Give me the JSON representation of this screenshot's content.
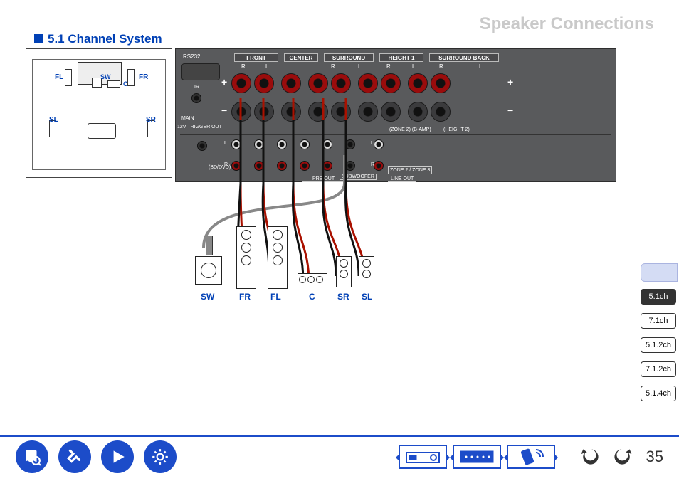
{
  "header": {
    "title": "Speaker Connections"
  },
  "section": {
    "title": "5.1 Channel System"
  },
  "room": {
    "labels": {
      "FL": "FL",
      "FR": "FR",
      "SW": "SW",
      "C": "C",
      "SL": "SL",
      "SR": "SR"
    }
  },
  "panel": {
    "port_labels": {
      "rs232": "RS232",
      "ir": "IR",
      "main": "MAIN",
      "trigger": "12V TRIGGER OUT",
      "subwoofer": "SUBWOOFER",
      "preout": "PRE OUT",
      "zone2_zone3": "ZONE 2 / ZONE 3",
      "lineout": "LINE OUT",
      "zone2_preamp": "(ZONE 2) (B-AMP)",
      "height2": "(HEIGHT 2)",
      "bd_dvd": "(BD/DVD)",
      "L": "L",
      "R": "R"
    },
    "groups": {
      "front": "FRONT",
      "center": "CENTER",
      "surround": "SURROUND",
      "height1": "HEIGHT 1",
      "surround_back": "SURROUND BACK"
    },
    "channel_letters": {
      "R": "R",
      "L": "L"
    },
    "polarity": {
      "plus": "+",
      "minus": "−"
    }
  },
  "speaker_labels": {
    "SW": "SW",
    "FR": "FR",
    "FL": "FL",
    "C": "C",
    "SR": "SR",
    "SL": "SL"
  },
  "tabs": {
    "items": [
      {
        "label": "5.1ch",
        "active": true
      },
      {
        "label": "7.1ch",
        "active": false
      },
      {
        "label": "5.1.2ch",
        "active": false
      },
      {
        "label": "7.1.2ch",
        "active": false
      },
      {
        "label": "5.1.4ch",
        "active": false
      }
    ]
  },
  "bottom_nav": {
    "icons": {
      "manual": "manual-icon",
      "cables": "cables-icon",
      "play": "play-icon",
      "settings": "settings-icon",
      "device_front": "device-front-icon",
      "device_rear": "device-rear-icon",
      "remote": "remote-icon",
      "undo": "undo-icon",
      "redo": "redo-icon"
    }
  },
  "page_number": "35"
}
